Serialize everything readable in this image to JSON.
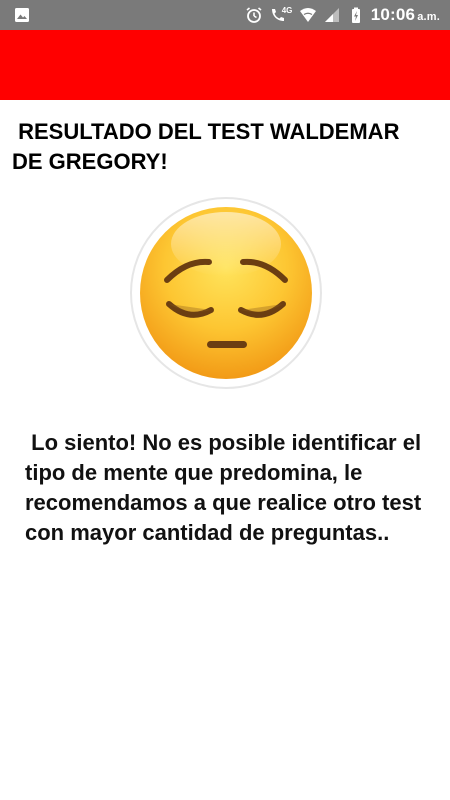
{
  "status_bar": {
    "time": "10:06",
    "ampm": "a.m.",
    "network": "4G",
    "left_icon": "image-icon",
    "right_icons": [
      "alarm-icon",
      "wifi-call-icon",
      "wifi-icon",
      "signal-icon",
      "battery-icon"
    ]
  },
  "app_bar": {
    "color": "#ff0000"
  },
  "result": {
    "title": " RESULTADO DEL TEST WALDEMAR DE GREGORY!",
    "message": " Lo siento! No es posible identificar el tipo de mente que predomina, le recomendamos a que realice otro test con mayor cantidad de preguntas..",
    "emoji": "sad-face-icon"
  }
}
